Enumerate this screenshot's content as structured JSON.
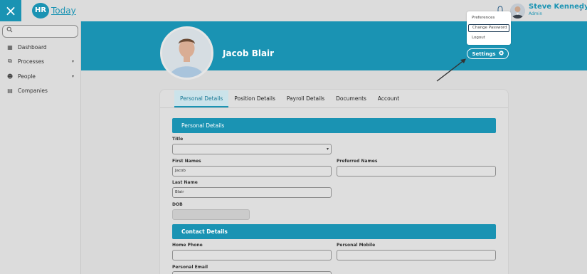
{
  "topbar": {
    "close_icon": "×",
    "logo_mark": "HR",
    "logo_text": "Today",
    "user_name": "Steve Kennedy",
    "user_role": "Admin",
    "caret": "⌄"
  },
  "sidebar": {
    "search_placeholder": "",
    "items": [
      {
        "label": "Dashboard",
        "icon": "▦",
        "has_chevron": false
      },
      {
        "label": "Processes",
        "icon": "⧉",
        "has_chevron": true
      },
      {
        "label": "People",
        "icon": "☻",
        "has_chevron": true
      },
      {
        "label": "Companies",
        "icon": "▤",
        "has_chevron": false
      }
    ],
    "chevron": "▾"
  },
  "profile": {
    "name": "Jacob Blair",
    "settings_label": "Settings",
    "settings_icon": "✿"
  },
  "menu": {
    "items": [
      "Preferences",
      "Change Password",
      "Logout"
    ],
    "active_index": 1
  },
  "tabs": [
    "Personal Details",
    "Position Details",
    "Payroll Details",
    "Documents",
    "Account"
  ],
  "active_tab": 0,
  "sections": {
    "personal": "Personal Details",
    "contact": "Contact Details"
  },
  "fields": {
    "title_label": "Title",
    "title_value": "",
    "first_names_label": "First Names",
    "first_names_value": "Jacob",
    "preferred_names_label": "Preferred Names",
    "preferred_names_value": "",
    "last_name_label": "Last Name",
    "last_name_value": "Blair",
    "dob_label": "DOB",
    "dob_value": "",
    "home_phone_label": "Home Phone",
    "home_phone_value": "",
    "personal_mobile_label": "Personal Mobile",
    "personal_mobile_value": "",
    "personal_email_label": "Personal Email"
  },
  "colors": {
    "accent": "#1a93b3",
    "dark": "#2a5d86"
  }
}
